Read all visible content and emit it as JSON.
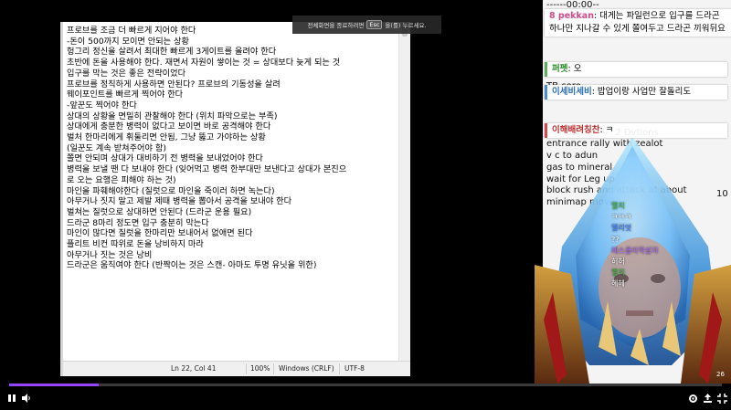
{
  "notepad": {
    "lines": [
      "프로브를 조금 더 빠르게 지어야 한다",
      "-돈이 500까지 모이면 안되는 상황",
      "헝그리 정신을 살려서 최대한 빠르게 3게이트를 올려야 한다",
      "초반에 돈을 사용해야 한다. 재면서 자원이 쌓이는 것 = 상대보다 늦게 되는 것",
      "입구를 막는 것은 좋은 전략이었다",
      "프로브를 정직하게 사용하면 안된다? 프로브의 기동성을 살려",
      "웨이포인트를 빠르게 찍어야 한다",
      "-앞꾼도 찍어야 한다",
      "상대의 상황을 면밀히 관찰해야 한다 (위치 파악으로는 부족)",
      "상대에게 충분한 병력이 없다고 보이면 바로 공격해야 한다",
      "벌처 한마리에게 휘둘리면 안됨, 그냥 뚫고 가야하는 상황",
      "(일꾼도 계속 받쳐주어야 함)",
      "쫄면 안되며 상대가 대비하기 전 병력을 보내었어야 한다",
      "병력을 보낼 땐 다 보내야 한다 (잊어먹고 병력 한부대만 보낸다고 상대가 본진으",
      "로 오는 요행은 피해야 하는 것)",
      "마인을 파훼해야한다 (질럿으로 마인을 죽이러 하면 녹는다)",
      "아무거나 짓지 말고 제발 제때 병력을 뽑아서 공격을 보내야 한다",
      "벌쳐는 질럿으로 상대하면 안된다 (드라군 운용 필요)",
      "드라군 8마리 정도면 입구 충분히 막는다",
      "마인이 많다면 질럿을 한마리만 보내어서 없애면 된다",
      "플리트 비컨 따위로 돈을 낭비하지 마라",
      "아무거나 짓는 것은 낭비",
      "드라군은 움직여야 한다 (반짝이는 것은 스캔- 아마도 투명 유닛을 위한)"
    ],
    "status": {
      "position": "Ln 22, Col 41",
      "zoom": "100%",
      "line_ending": "Windows (CRLF)",
      "encoding": "UTF-8"
    }
  },
  "toast": {
    "prefix": "전체화면을 종료하려면",
    "key": "Esc",
    "suffix": "을(를) 누르세요."
  },
  "right_panel": {
    "lines": [
      "------00:00--",
      "",
      "",
      "",
      "",
      "",
      "",
      "TB core",
      "",
      "",
      "",
      "------05:30------ 2 Dvtions",
      "entrance rally with zealot",
      "v c to adun",
      "gas to mineral",
      "wait for Leg up",
      "block rush and attack at about",
      "minimap move"
    ],
    "trailing_number": "10"
  },
  "chat": [
    {
      "nick": "8 pekkan",
      "text": ": 대게는 파일런으로 입구를 드라곤 하나만 지나갈 수 있게 쫄여두고 드라곤 끼워뒤요",
      "color": "#d04a8a",
      "bar": "none"
    },
    {
      "nick": "퍼펫",
      "text": ": 오",
      "color": "#2f8f2f",
      "bar": "green"
    },
    {
      "nick": "이세비세비",
      "text": ": 밥업이랑 사업만 잘돌리도",
      "color": "#2a6fb8",
      "bar": "blue"
    },
    {
      "nick": "이해배려칭찬",
      "text": ": ㅋ",
      "color": "#c03030",
      "bar": "red"
    }
  ],
  "mini_chat": [
    {
      "text": "멸치",
      "color": "#2fbf2f"
    },
    {
      "text": "ㅋㅋㅋ",
      "color": "#ffffff"
    },
    {
      "text": "엘리엇",
      "color": "#3a7aff"
    },
    {
      "text": "??",
      "color": "#ffffff"
    },
    {
      "text": "테스클라학살자",
      "color": "#b06aff"
    },
    {
      "text": "허허",
      "color": "#ffffff"
    },
    {
      "text": "멸치",
      "color": "#2fbf2f"
    },
    {
      "text": "헤헤",
      "color": "#ffffff"
    }
  ],
  "viewer_badge": "26",
  "player": {
    "progress_fraction": 0.126,
    "accent": "#9147ff"
  }
}
